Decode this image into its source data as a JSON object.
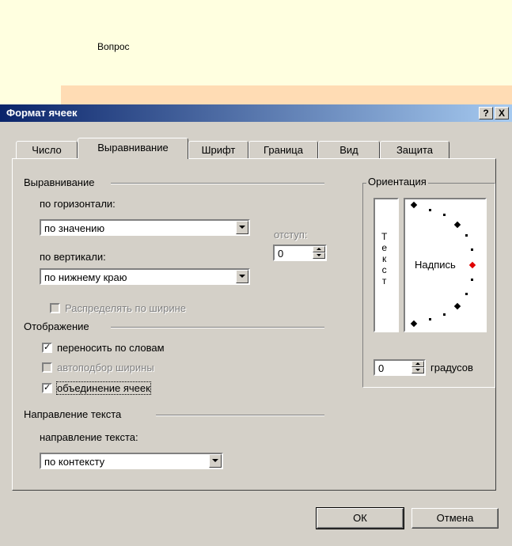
{
  "sheet": {
    "cell_text": "Вопрос"
  },
  "dialog": {
    "title": "Формат ячеек",
    "help_btn": "?",
    "close_btn": "X",
    "tabs": [
      "Число",
      "Выравнивание",
      "Шрифт",
      "Граница",
      "Вид",
      "Защита"
    ],
    "active_tab": "Выравнивание",
    "alignment": {
      "group_label": "Выравнивание",
      "horizontal_label": "по горизонтали:",
      "horizontal_value": "по значению",
      "vertical_label": "по вертикали:",
      "vertical_value": "по нижнему краю",
      "indent_label": "отступ:",
      "indent_value": "0",
      "justify_distributed_label": "Распределять по ширине"
    },
    "display": {
      "group_label": "Отображение",
      "wrap_label": "переносить по словам",
      "wrap_checked": true,
      "shrink_label": "автоподбор ширины",
      "shrink_checked": false,
      "merge_label": "объединение ячеек",
      "merge_checked": true
    },
    "direction": {
      "group_label": "Направление текста",
      "direction_label": "направление текста:",
      "direction_value": "по контексту"
    },
    "orientation": {
      "group_label": "Ориентация",
      "vertical_text": [
        "Т",
        "е",
        "к",
        "с",
        "т"
      ],
      "sample_label": "Надпись",
      "degrees_value": "0",
      "degrees_label": "градусов",
      "accent_color": "#e00000"
    },
    "buttons": {
      "ok": "ОК",
      "cancel": "Отмена"
    }
  }
}
